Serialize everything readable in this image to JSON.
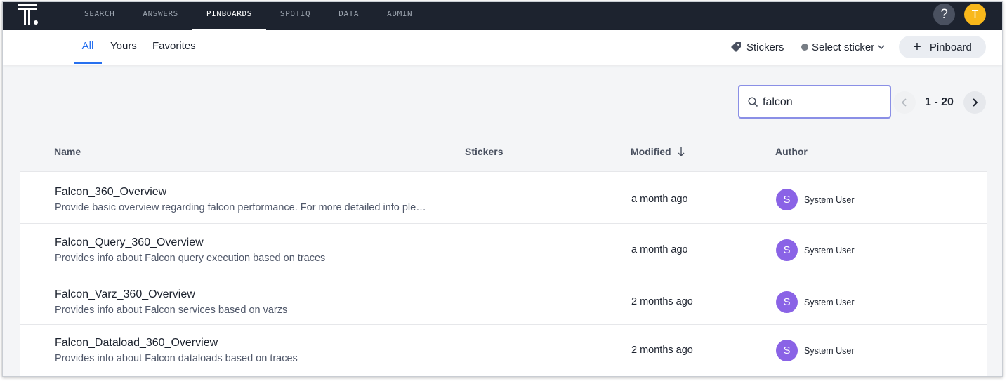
{
  "nav": {
    "items": [
      {
        "label": "SEARCH",
        "active": false
      },
      {
        "label": "ANSWERS",
        "active": false
      },
      {
        "label": "PINBOARDS",
        "active": true
      },
      {
        "label": "SPOTIQ",
        "active": false
      },
      {
        "label": "DATA",
        "active": false
      },
      {
        "label": "ADMIN",
        "active": false
      }
    ],
    "help_label": "?",
    "user_initial": "T"
  },
  "tabs": {
    "all": "All",
    "yours": "Yours",
    "favorites": "Favorites",
    "active": "All"
  },
  "toolbar": {
    "stickers_label": "Stickers",
    "select_sticker_label": "Select sticker",
    "pinboard_button_label": "Pinboard"
  },
  "search": {
    "value": "falcon"
  },
  "pager": {
    "range": "1 - 20"
  },
  "table": {
    "headers": {
      "name": "Name",
      "stickers": "Stickers",
      "modified": "Modified",
      "author": "Author"
    },
    "sort": "Modified descending",
    "rows": [
      {
        "title": "Falcon_360_Overview",
        "description": "Provide basic overview regarding falcon performance. For more detailed info ple…",
        "modified": "a month ago",
        "author_initial": "S",
        "author": "System User"
      },
      {
        "title": "Falcon_Query_360_Overview",
        "description": "Provides info about Falcon query execution based on traces",
        "modified": "a month ago",
        "author_initial": "S",
        "author": "System User"
      },
      {
        "title": "Falcon_Varz_360_Overview",
        "description": "Provides info about Falcon services based on varzs",
        "modified": "2 months ago",
        "author_initial": "S",
        "author": "System User"
      },
      {
        "title": "Falcon_Dataload_360_Overview",
        "description": "Provides info about Falcon dataloads based on traces",
        "modified": "2 months ago",
        "author_initial": "S",
        "author": "System User"
      }
    ]
  },
  "colors": {
    "topbar": "#1d232f",
    "accent": "#2770ef",
    "user_avatar": "#f9b81b",
    "author_avatar": "#8a63e6",
    "search_focus": "#8a8fe6"
  }
}
